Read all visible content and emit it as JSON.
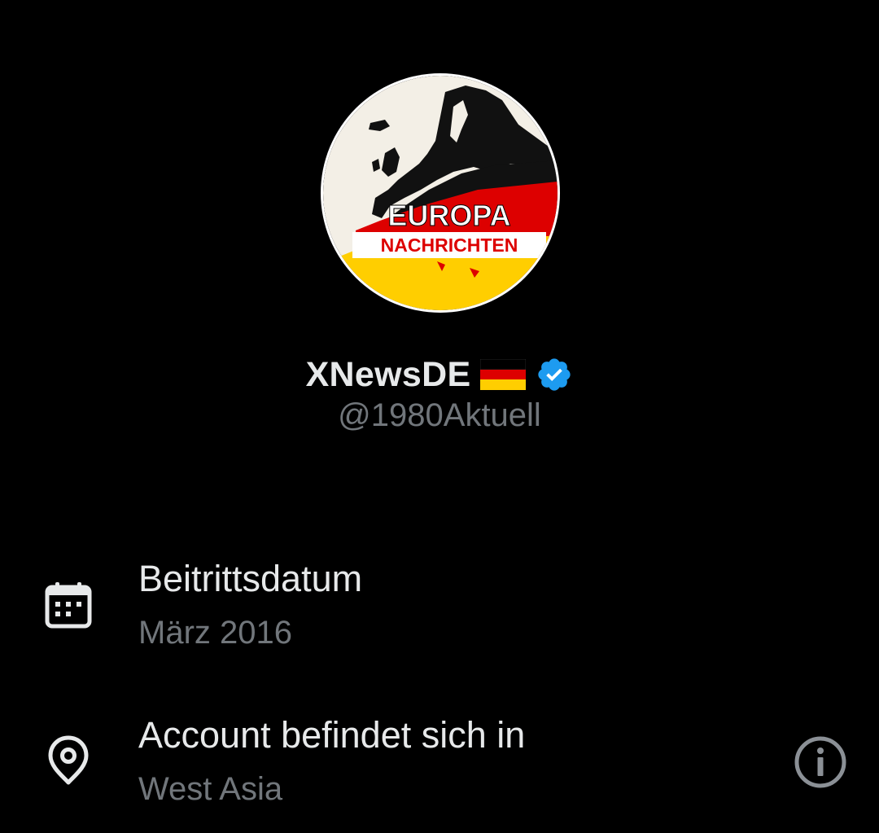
{
  "profile": {
    "avatar_text_line1": "EUROPA",
    "avatar_text_line2": "NACHRICHTEN",
    "display_name": "XNewsDE",
    "flag_icon": "germany-flag-icon",
    "verified_icon": "verified-badge-icon",
    "handle": "@1980Aktuell"
  },
  "details": {
    "joined": {
      "icon": "calendar-icon",
      "title": "Beitrittsdatum",
      "value": "März 2016"
    },
    "location": {
      "icon": "location-pin-icon",
      "title": "Account befindet sich in",
      "value": "West Asia",
      "info_icon": "info-icon"
    }
  },
  "colors": {
    "background": "#000000",
    "primary_text": "#e7e9ea",
    "secondary_text": "#71767b",
    "verified_blue": "#1d9bf0",
    "flag_black": "#000000",
    "flag_red": "#dd0000",
    "flag_gold": "#ffce00"
  }
}
